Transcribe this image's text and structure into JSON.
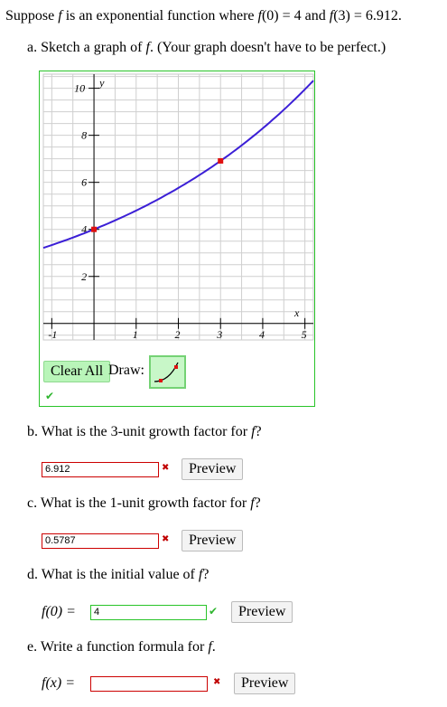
{
  "problem": {
    "intro": "Suppose f is an exponential function where f(0) = 4 and f(3) = 6.912.",
    "part_a": "a. Sketch a graph of f. (Your graph doesn't have to be perfect.)",
    "part_b": "b. What is the 3-unit growth factor for f?",
    "part_c": "c. What is the 1-unit growth factor for f?",
    "part_d": "d. What is the initial value of f?",
    "part_e": "e. Write a function formula for f."
  },
  "graph_tools": {
    "clear_all": "Clear All",
    "draw_label": "Draw:"
  },
  "answers": {
    "b_value": "6.912",
    "c_value": "0.5787",
    "d_value": "4",
    "e_value": "",
    "d_label": "f(0) =",
    "e_label": "f(x) ="
  },
  "preview_label": "Preview",
  "status": {
    "graph": "correct",
    "b": "incorrect",
    "c": "incorrect",
    "d": "correct",
    "e": "incorrect"
  },
  "colors": {
    "curve": "#3b1fd6",
    "point": "#e01010",
    "correct": "#2fb52f",
    "incorrect": "#c00000",
    "grid": "#cfcfcf"
  },
  "chart_data": {
    "type": "line",
    "xlabel": "x",
    "ylabel": "y",
    "xlim": [
      -1.2,
      5.2
    ],
    "ylim": [
      -0.7,
      10.6
    ],
    "x_ticks": [
      "-1",
      "1",
      "2",
      "3",
      "4",
      "5"
    ],
    "y_ticks": [
      "2",
      "4",
      "6",
      "8",
      "10"
    ],
    "grid": true,
    "series": [
      {
        "function": "4 * 1.2^x",
        "x": [
          -1.2,
          0,
          1,
          2,
          3,
          4,
          5.2
        ],
        "y": [
          3.2,
          4,
          4.8,
          5.76,
          6.912,
          8.29,
          10.3
        ]
      }
    ],
    "points": [
      {
        "x": 0,
        "y": 4
      },
      {
        "x": 3,
        "y": 6.912
      }
    ]
  }
}
